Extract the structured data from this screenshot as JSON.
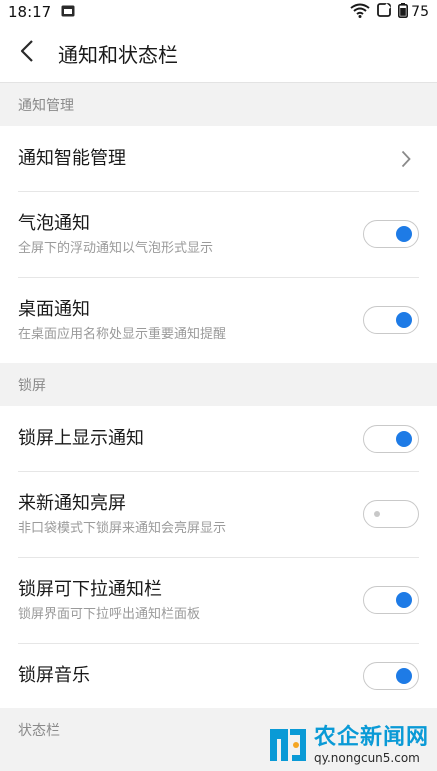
{
  "status_bar": {
    "time": "18:17",
    "battery": "75",
    "icons": [
      "sim-card-icon",
      "wifi-icon",
      "screen-rotate-icon",
      "battery-icon"
    ]
  },
  "header": {
    "title": "通知和状态栏",
    "back_icon": "back-arrow-icon"
  },
  "sections": {
    "notification": {
      "header": "通知管理",
      "smart": {
        "title": "通知智能管理",
        "icon": "chevron-right-icon"
      },
      "bubble": {
        "title": "气泡通知",
        "subtitle": "全屏下的浮动通知以气泡形式显示",
        "enabled": true
      },
      "desktop": {
        "title": "桌面通知",
        "subtitle": "在桌面应用名称处显示重要通知提醒",
        "enabled": true
      }
    },
    "lockscreen": {
      "header": "锁屏",
      "show": {
        "title": "锁屏上显示通知",
        "enabled": true
      },
      "wake": {
        "title": "来新通知亮屏",
        "subtitle": "非口袋模式下锁屏来通知会亮屏显示",
        "enabled": false
      },
      "pulldown": {
        "title": "锁屏可下拉通知栏",
        "subtitle": "锁屏界面可下拉呼出通知栏面板",
        "enabled": true
      },
      "music": {
        "title": "锁屏音乐",
        "enabled": true
      }
    },
    "statusbar": {
      "header": "状态栏"
    }
  },
  "watermark": {
    "title": "农企新闻网",
    "url": "qy.nongcun5.com"
  },
  "colors": {
    "accent": "#1e7be6",
    "background": "#f2f2f2",
    "watermark": "#0a9ad6"
  }
}
